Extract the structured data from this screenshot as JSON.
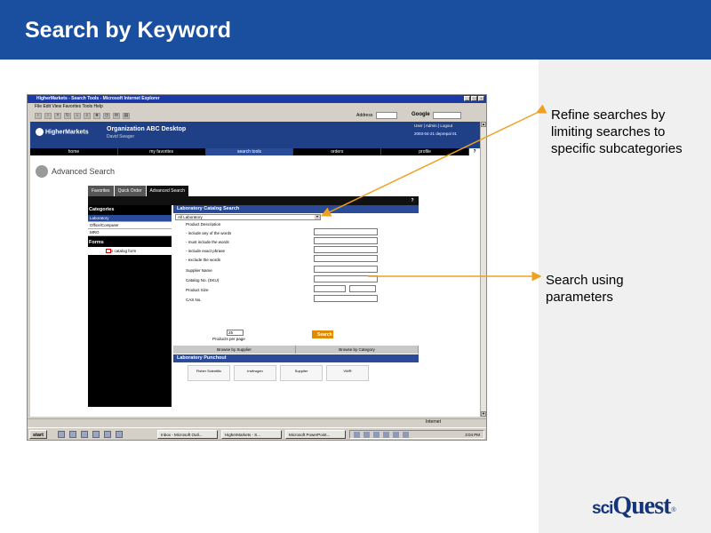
{
  "slide": {
    "title": "Search by Keyword",
    "callout_1": "Refine searches by limiting searches to specific subcategories",
    "callout_2": "Search using parameters",
    "logo_sci": "sci",
    "logo_quest": "Quest",
    "logo_tm": "®"
  },
  "window": {
    "title": "HigherMarkets - Search Tools - Microsoft Internet Explorer",
    "menu": "File   Edit   View   Favorites   Tools   Help",
    "address_label": "Address",
    "google_label": "Google"
  },
  "app": {
    "logo": "HigherMarkets",
    "org_title": "Organization ABC Desktop",
    "org_sub": "David Swager",
    "user_links": "User | Admin | Logout",
    "date": "2003-04-21  deprepal 01",
    "nav": [
      {
        "label": "home"
      },
      {
        "label": "my favorites"
      },
      {
        "label": "search tools"
      },
      {
        "label": "orders"
      },
      {
        "label": "profile"
      }
    ],
    "nav_help": "?",
    "advanced_search": "Advanced Search",
    "tabs": [
      "Favorites",
      "Quick Order",
      "Advanced Search"
    ],
    "panel_help": "?"
  },
  "categories": {
    "heading": "Categories",
    "items": [
      "Laboratory",
      "Office/Computer",
      "MRO"
    ],
    "forms_heading": "Forms",
    "form_item": "Non catalog form"
  },
  "search": {
    "heading": "Laboratory Catalog Search",
    "category_select": "All Laboratory",
    "fields": [
      "Product Description",
      "- include any of the words",
      "- must include the words",
      "- include exact phrase",
      "- exclude the words",
      "Supplier Name",
      "Catalog No. (SKU)",
      "Product Size",
      "CAS No."
    ],
    "per_page_value": "25",
    "per_page_label": "Products per page",
    "search_button": "Search",
    "sub_tabs": [
      "Browse by Supplier",
      "Browse by Category"
    ],
    "punchout_heading": "Laboratory Punchout",
    "suppliers": [
      "Fisher Scientific",
      "Invitrogen",
      "Supplier",
      "VWR"
    ]
  },
  "status": {
    "internet": "Internet",
    "start": "start",
    "tasks": [
      "Inbox - Microsoft Outl...",
      "HigherMarkets - S...",
      "Microsoft PowerPoint..."
    ],
    "clock": "3:04 PM"
  }
}
